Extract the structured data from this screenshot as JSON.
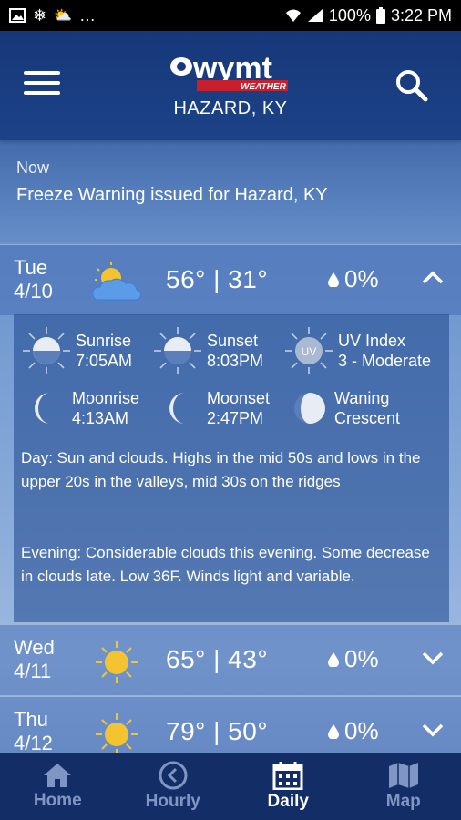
{
  "status_bar": {
    "battery": "100%",
    "time": "3:22 PM",
    "left_icons": [
      "image-icon",
      "snowflake-icon",
      "cloud-sun-icon",
      "more-icon"
    ]
  },
  "header": {
    "logo_text": "wymt",
    "logo_sub": "WEATHER",
    "location": "HAZARD, KY"
  },
  "alert": {
    "label": "Now",
    "text": "Freeze Warning issued for Hazard, KY"
  },
  "days": [
    {
      "day": "Tue",
      "date": "4/10",
      "icon": "partly-cloudy-icon",
      "temps": "56° | 31°",
      "precip": "0%",
      "expanded": true
    },
    {
      "day": "Wed",
      "date": "4/11",
      "icon": "sunny-icon",
      "temps": "65° | 43°",
      "precip": "0%",
      "expanded": false
    },
    {
      "day": "Thu",
      "date": "4/12",
      "icon": "sunny-icon",
      "temps": "79° | 50°",
      "precip": "0%",
      "expanded": false
    }
  ],
  "detail": {
    "sunrise_label": "Sunrise",
    "sunrise_value": "7:05AM",
    "sunset_label": "Sunset",
    "sunset_value": "8:03PM",
    "uv_label": "UV Index",
    "uv_value": "3 - Moderate",
    "moonrise_label": "Moonrise",
    "moonrise_value": "4:13AM",
    "moonset_label": "Moonset",
    "moonset_value": "2:47PM",
    "phase_line1": "Waning",
    "phase_line2": "Crescent",
    "day_text": "Day: Sun and clouds. Highs in the mid 50s and lows in the upper 20s in the valleys, mid 30s on the ridges",
    "evening_text": "Evening: Considerable clouds this evening. Some decrease in clouds late. Low 36F. Winds light and variable."
  },
  "nav": [
    {
      "label": "Home",
      "icon": "home-icon",
      "active": false
    },
    {
      "label": "Hourly",
      "icon": "clock-icon",
      "active": false
    },
    {
      "label": "Daily",
      "icon": "calendar-icon",
      "active": true
    },
    {
      "label": "Map",
      "icon": "map-icon",
      "active": false
    }
  ]
}
